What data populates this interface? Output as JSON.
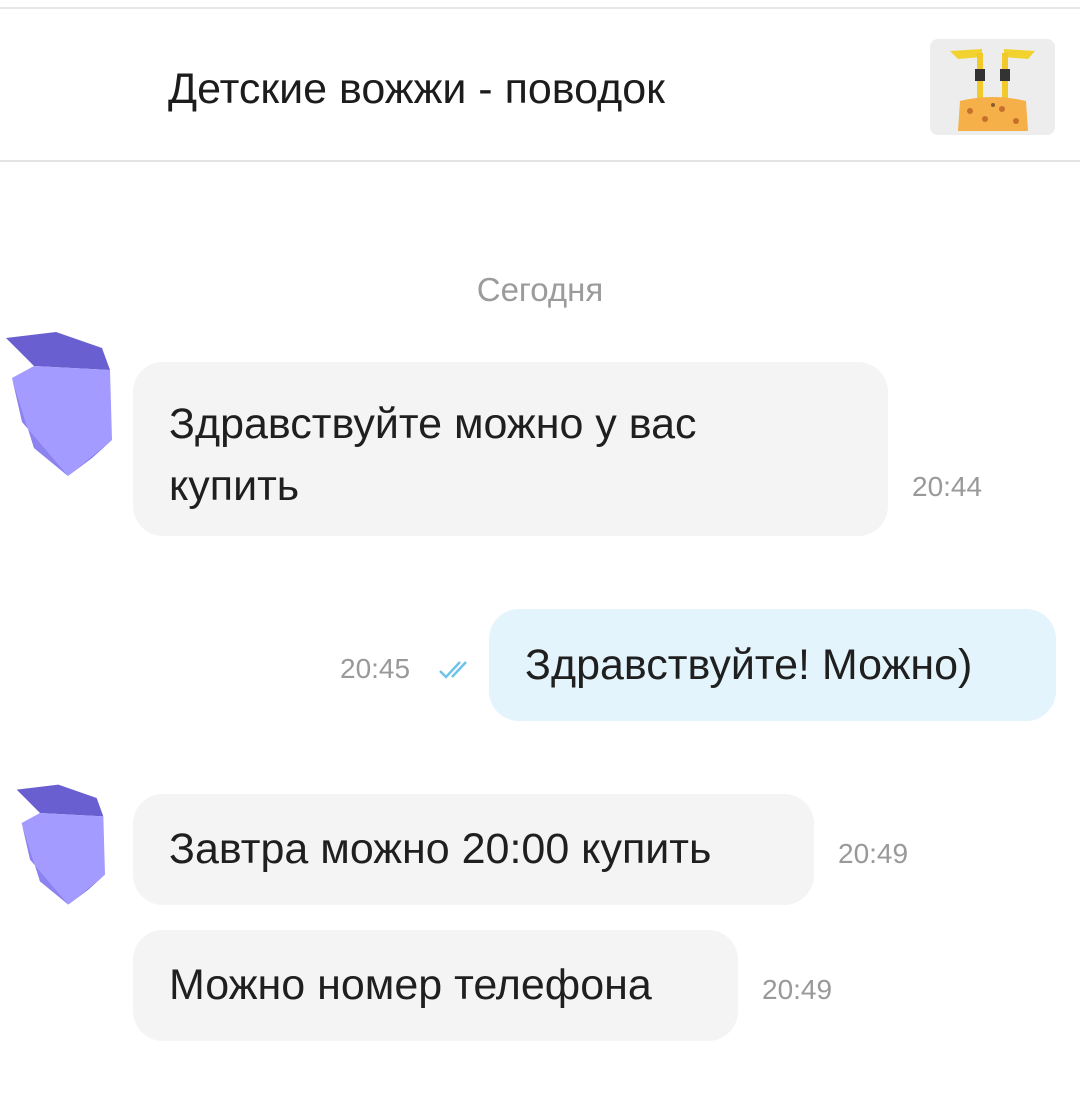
{
  "header": {
    "title": "Детские вожжи - поводок",
    "product_thumbnail": "child-harness-photo"
  },
  "chat": {
    "date_separator": "Сегодня",
    "messages": [
      {
        "direction": "incoming",
        "line1": "Здравствуйте можно у вас",
        "line2": "купить",
        "time": "20:44"
      },
      {
        "direction": "outgoing",
        "text": "Здравствуйте! Можно)",
        "time": "20:45",
        "status": "read"
      },
      {
        "direction": "incoming",
        "text": "Завтра можно 20:00 купить",
        "time": "20:49"
      },
      {
        "direction": "incoming",
        "text": "Можно номер телефона",
        "time": "20:49"
      }
    ]
  },
  "colors": {
    "incoming_bubble": "#f4f4f4",
    "outgoing_bubble": "#e3f4fc",
    "avatar_purple": "#a39bff",
    "read_checks": "#6fc3e8",
    "timestamp": "#999999"
  },
  "icons": {
    "avatar": "purple-polygon-avatar-icon",
    "read_status": "double-check-icon"
  }
}
